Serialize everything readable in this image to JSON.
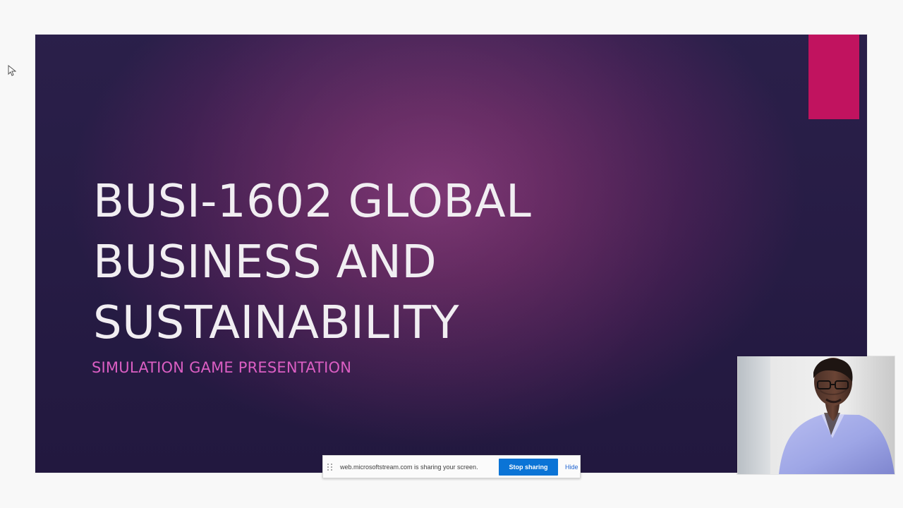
{
  "slide": {
    "title": "BUSI-1602 GLOBAL\nBUSINESS AND\nSUSTAINABILITY",
    "subtitle": "SIMULATION GAME PRESENTATION"
  },
  "screen_share_bar": {
    "message": "web.microsoftstream.com is sharing your screen.",
    "stop_label": "Stop sharing",
    "hide_label": "Hide"
  },
  "colors": {
    "slide_background_center": "#7C2D70",
    "slide_background_edge": "#2F2459",
    "accent": "#C1135F",
    "subtitle": "#DB5EC3",
    "share_button": "#0B74D6"
  },
  "icons": {
    "cursor": "mouse-pointer-icon",
    "drag_handle": "drag-handle-icon"
  }
}
